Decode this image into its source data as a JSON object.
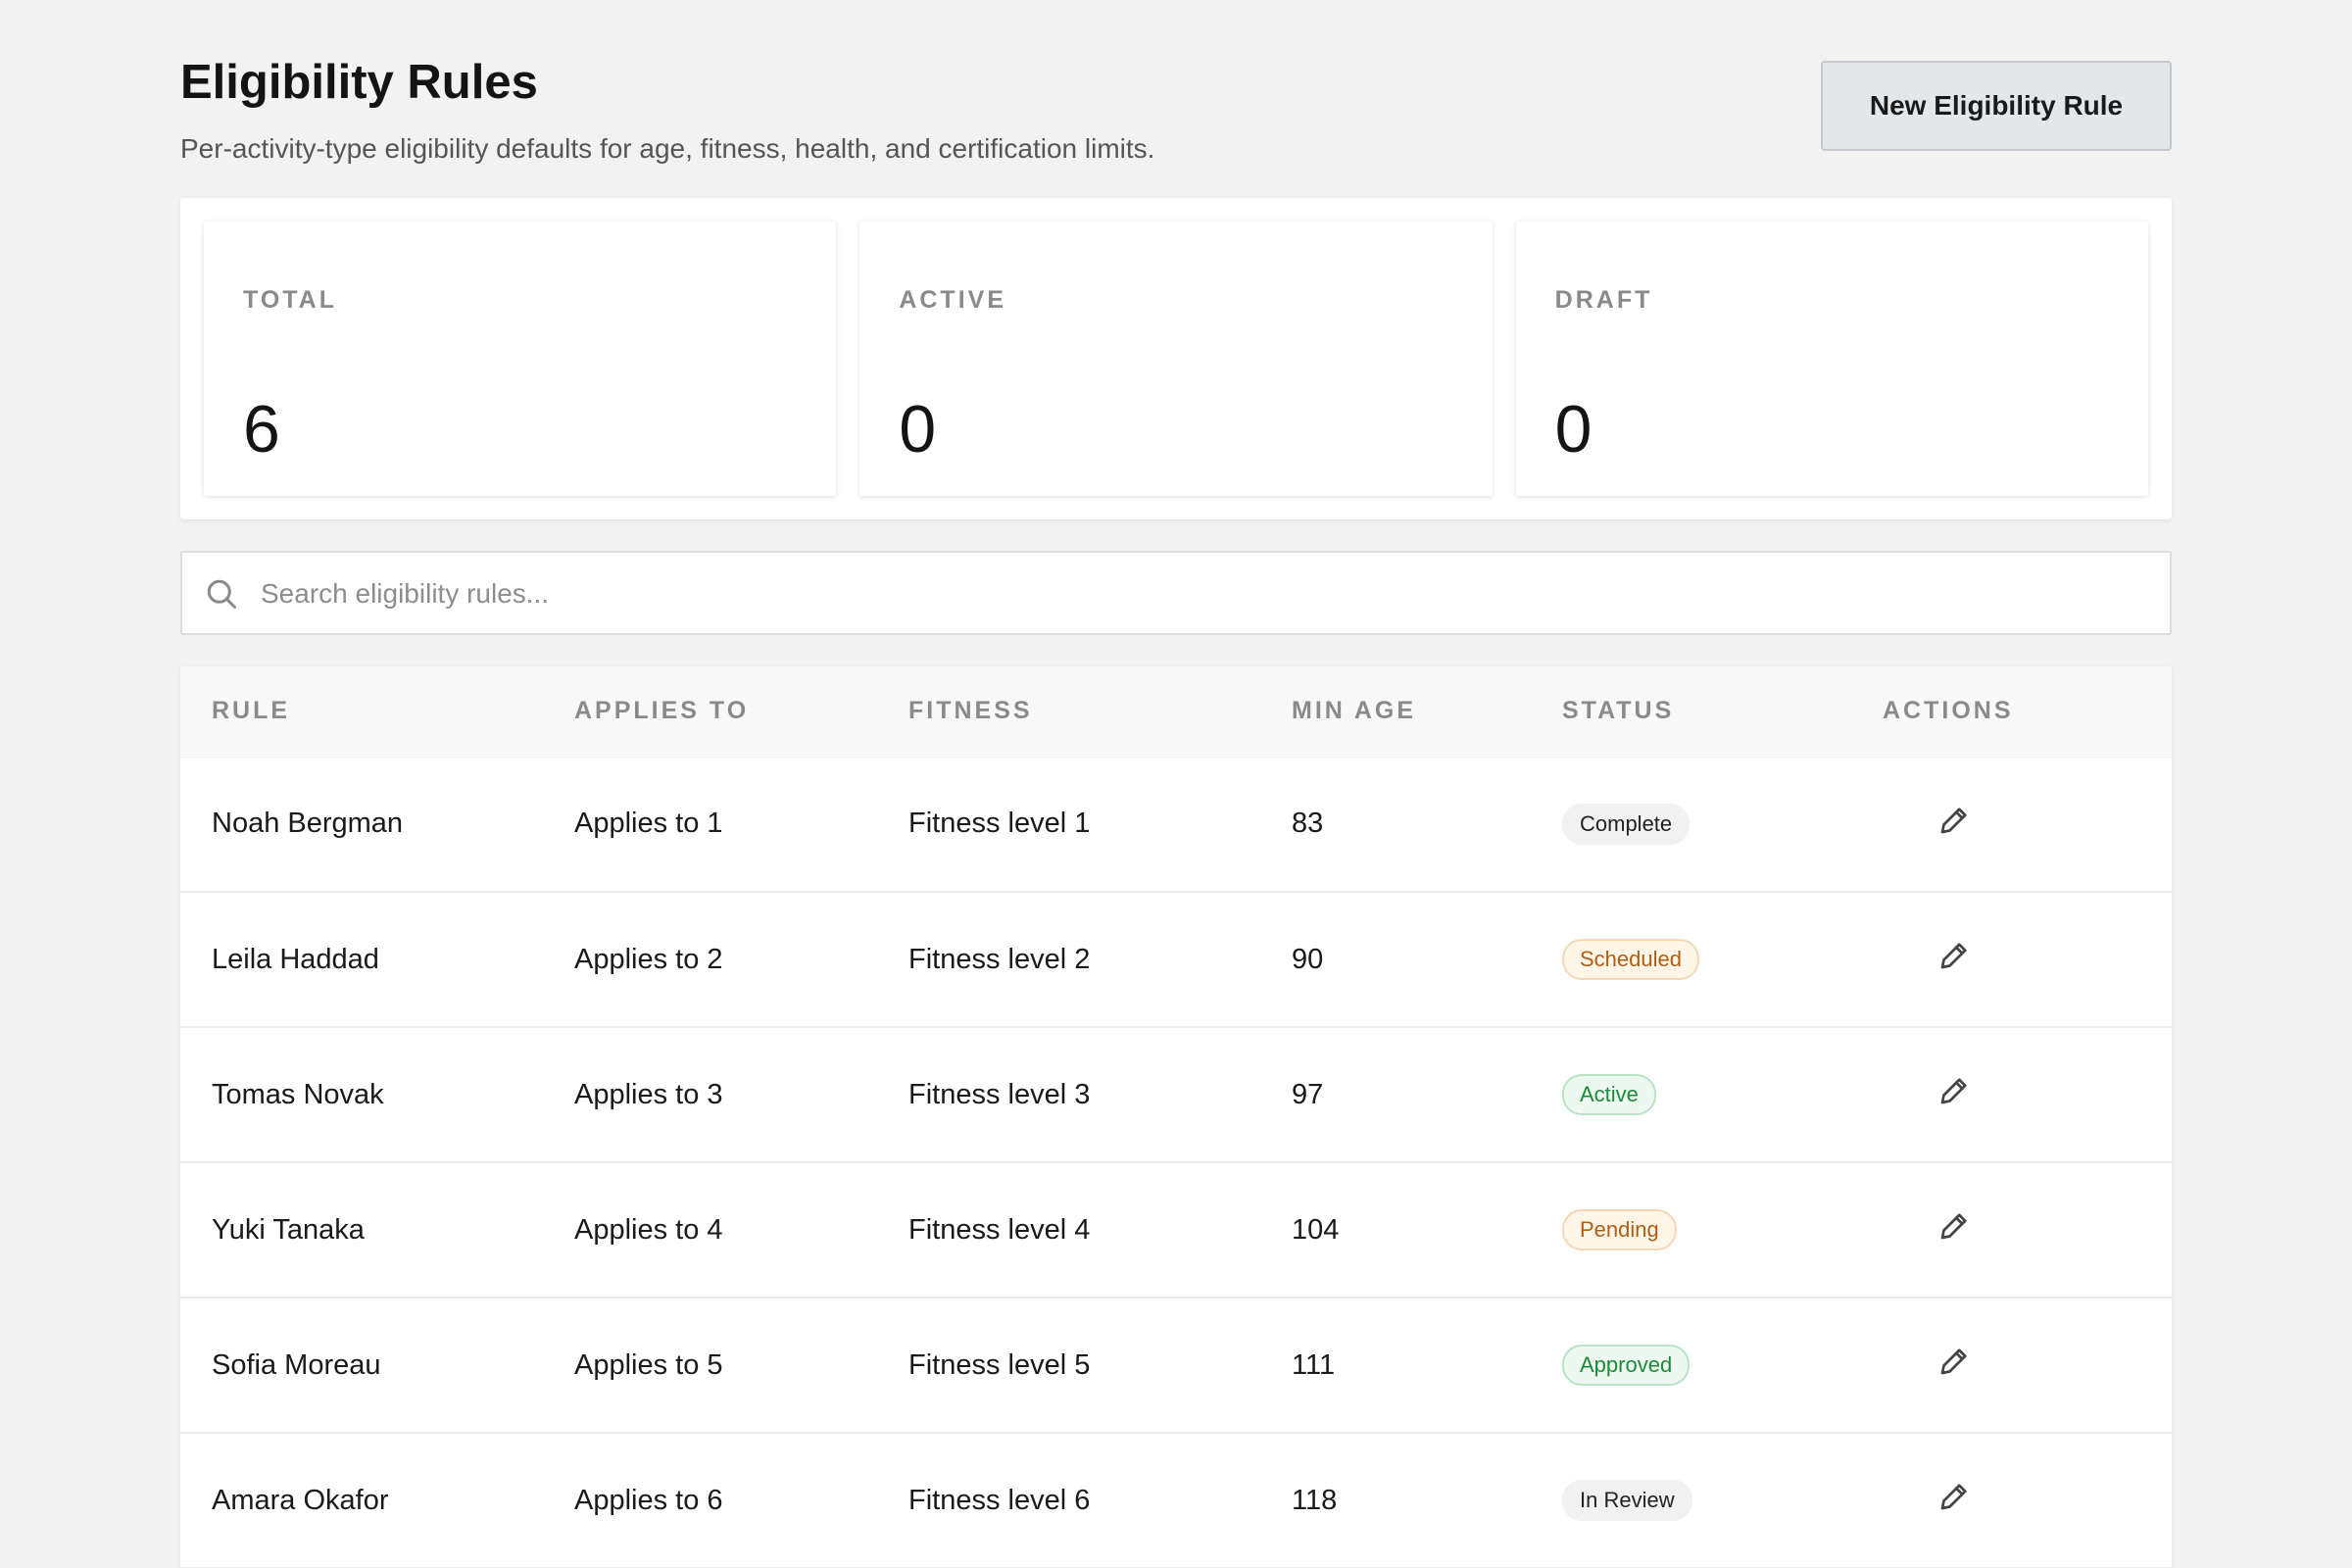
{
  "header": {
    "title": "Eligibility Rules",
    "subtitle": "Per-activity-type eligibility defaults for age, fitness, health, and certification limits.",
    "new_button_label": "New Eligibility Rule"
  },
  "stats": [
    {
      "label": "TOTAL",
      "value": "6"
    },
    {
      "label": "ACTIVE",
      "value": "0"
    },
    {
      "label": "DRAFT",
      "value": "0"
    }
  ],
  "search": {
    "placeholder": "Search eligibility rules...",
    "icon": "search-icon"
  },
  "table": {
    "columns": [
      "RULE",
      "APPLIES TO",
      "FITNESS",
      "MIN AGE",
      "STATUS",
      "ACTIONS"
    ],
    "rows": [
      {
        "rule": "Noah Bergman",
        "applies_to": "Applies to 1",
        "fitness": "Fitness level 1",
        "min_age": "83",
        "status": "Complete",
        "status_tone": "neutral"
      },
      {
        "rule": "Leila Haddad",
        "applies_to": "Applies to 2",
        "fitness": "Fitness level 2",
        "min_age": "90",
        "status": "Scheduled",
        "status_tone": "warn"
      },
      {
        "rule": "Tomas Novak",
        "applies_to": "Applies to 3",
        "fitness": "Fitness level 3",
        "min_age": "97",
        "status": "Active",
        "status_tone": "ok"
      },
      {
        "rule": "Yuki Tanaka",
        "applies_to": "Applies to 4",
        "fitness": "Fitness level 4",
        "min_age": "104",
        "status": "Pending",
        "status_tone": "warn"
      },
      {
        "rule": "Sofia Moreau",
        "applies_to": "Applies to 5",
        "fitness": "Fitness level 5",
        "min_age": "111",
        "status": "Approved",
        "status_tone": "ok"
      },
      {
        "rule": "Amara Okafor",
        "applies_to": "Applies to 6",
        "fitness": "Fitness level 6",
        "min_age": "118",
        "status": "In Review",
        "status_tone": "neutral"
      }
    ],
    "row_action_icon": "pencil-icon"
  },
  "colors": {
    "background": "#f2f2f2",
    "status_warn": "#b25e12",
    "status_ok": "#1d8a3a"
  }
}
